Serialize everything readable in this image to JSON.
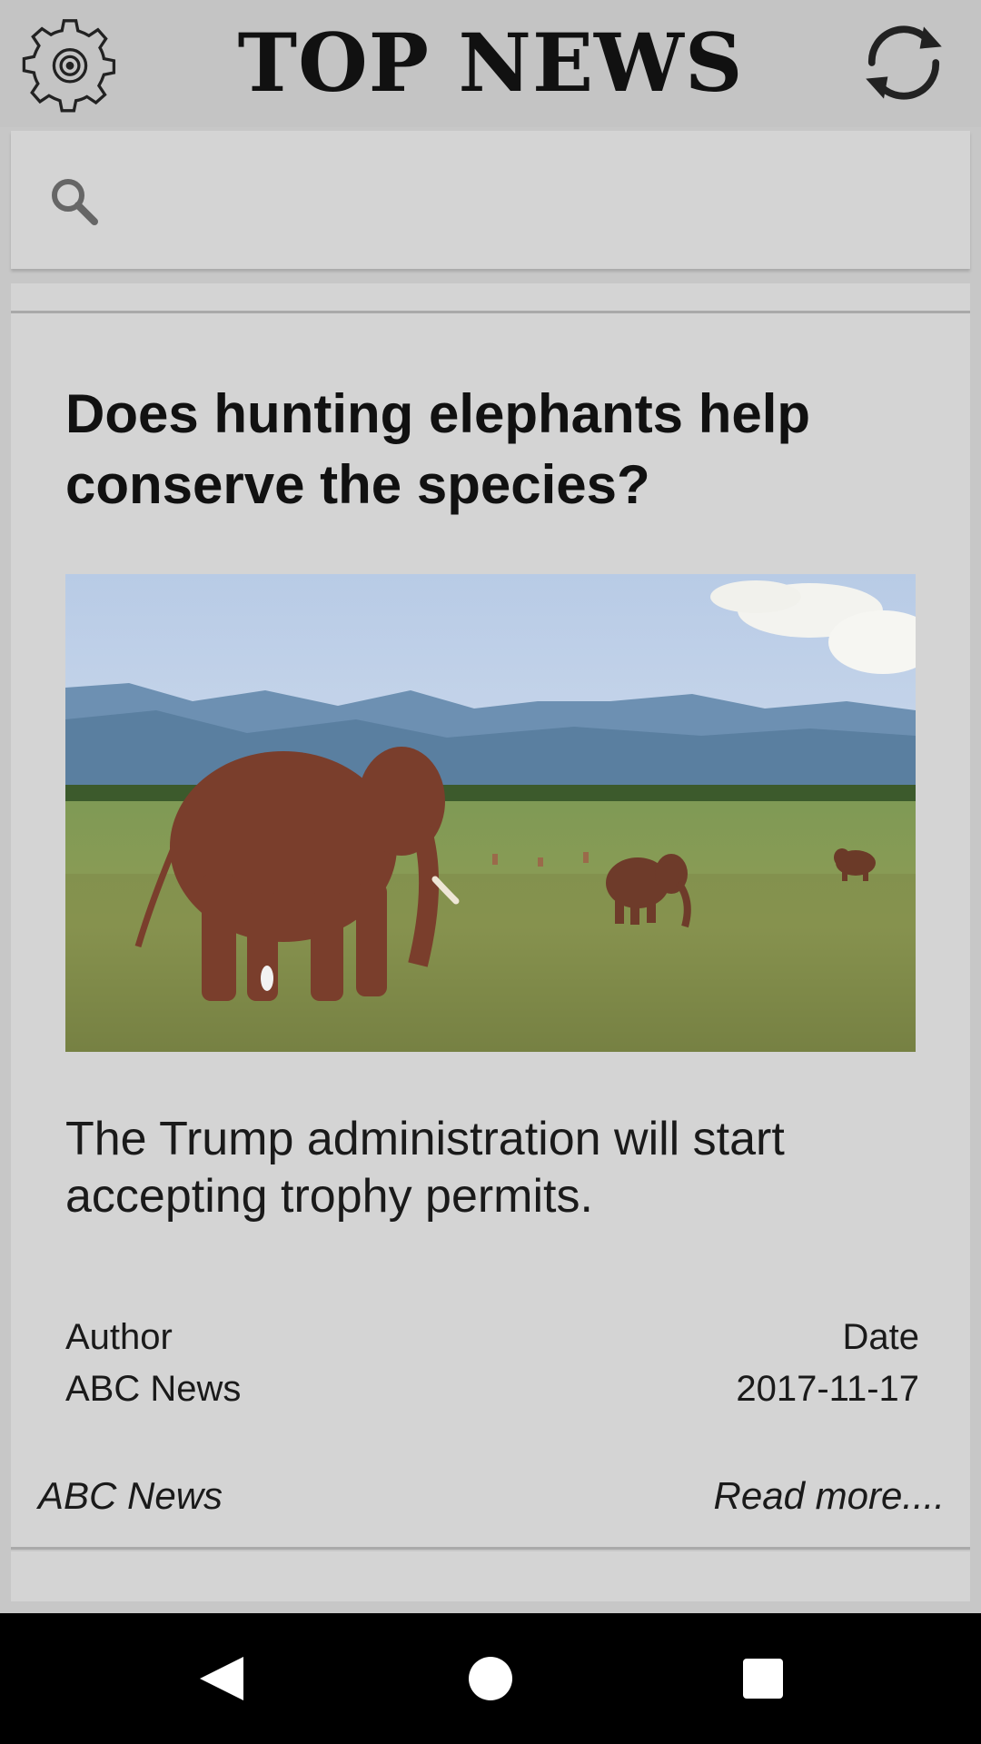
{
  "app_bar": {
    "title": "TOP NEWS",
    "settings_icon": "gear-icon",
    "refresh_icon": "refresh-icon"
  },
  "search": {
    "icon": "search-icon",
    "placeholder": ""
  },
  "article": {
    "headline": "Does hunting elephants help conserve the species?",
    "image_icon": "photo-elephants-savanna",
    "summary": "The Trump administration will start accepting trophy permits.",
    "author_label": "Author",
    "author": "ABC News",
    "date_label": "Date",
    "date": "2017-11-17",
    "source": "ABC News",
    "read_more": "Read more...."
  },
  "system_nav": {
    "back_icon": "back-triangle-icon",
    "home_icon": "home-circle-icon",
    "recents_icon": "recents-square-icon"
  },
  "colors": {
    "background": "#c7c7c7",
    "card": "#d4d4d4",
    "text": "#111111",
    "nav_bar": "#000000"
  }
}
